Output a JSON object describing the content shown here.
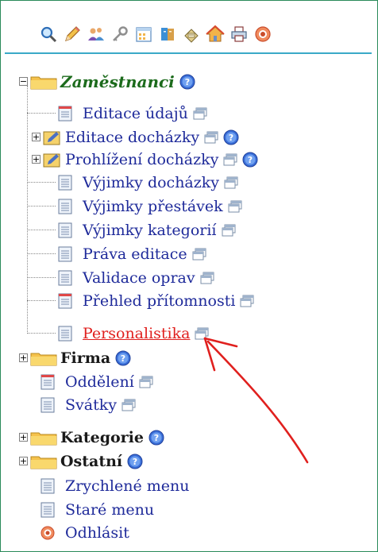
{
  "toolbar": {
    "icons": [
      "search-icon",
      "pencil-icon",
      "users-icon",
      "key-icon",
      "calendar-icon",
      "book-icon",
      "printer-doc-icon",
      "home-icon",
      "printer-icon",
      "logout-icon"
    ]
  },
  "tree": {
    "zamestnanci": {
      "label": "Zaměstnanci",
      "children": [
        "Editace údajů",
        "Editace docházky",
        "Prohlížení docházky",
        "Výjimky docházky",
        "Výjimky přestávek",
        "Výjimky kategorií",
        "Práva editace",
        "Validace oprav",
        "Přehled přítomnosti",
        "Personalistika"
      ]
    },
    "firma": {
      "label": "Firma",
      "children": [
        "Oddělení",
        "Svátky"
      ]
    },
    "kategorie": {
      "label": "Kategorie"
    },
    "ostatni": {
      "label": "Ostatní"
    },
    "bottom": [
      "Zrychlené menu",
      "Staré menu",
      "Odhlásit"
    ]
  },
  "colors": {
    "accent": "#3aa9c7",
    "link": "#1e2a9a",
    "active": "#e0201e",
    "heading": "#1c6b1c",
    "arrow": "#e0201e"
  }
}
